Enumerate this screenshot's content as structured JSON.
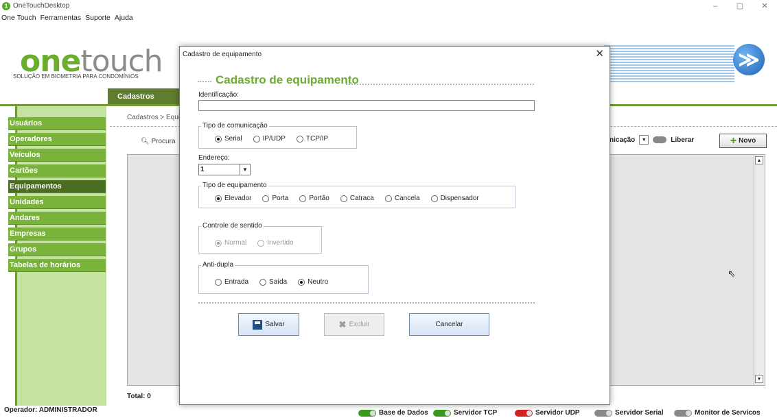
{
  "window": {
    "title": "OneTouchDesktop",
    "icon_glyph": "1",
    "minimize": "–",
    "restore": "▢",
    "close": "✕"
  },
  "menu": [
    "One Touch",
    "Ferramentas",
    "Suporte",
    "Ajuda"
  ],
  "brand": {
    "logo_one": "one",
    "logo_touch": "touch",
    "tagline": "SOLUÇÃO EM BIOMETRIA PARA CONDOMÍNIOS",
    "globe_glyph": "≫"
  },
  "main_tab": "Cadastros",
  "sidebar": {
    "items": [
      "Usuários",
      "Operadores",
      "Veículos",
      "Cartões",
      "Equipamentos",
      "Unidades",
      "Andares",
      "Empresas",
      "Grupos",
      "Tabelas de horários"
    ],
    "active": "Equipamentos"
  },
  "content": {
    "breadcrumb": "Cadastros > Equi",
    "search_label": "Procura",
    "comm_combo": "nicação",
    "liberar": "Liberar",
    "novo": "Novo",
    "total": "Total: 0"
  },
  "status": {
    "operator": "Operador: ADMINISTRADOR",
    "services": [
      {
        "label": "Base de Dados",
        "color": "#3a9a1f"
      },
      {
        "label": "Servidor TCP",
        "color": "#3a9a1f"
      },
      {
        "label": "Servidor UDP",
        "color": "#d42020"
      },
      {
        "label": "Servidor Serial",
        "color": "#8a8a8a"
      },
      {
        "label": "Monitor de Servicos",
        "color": "#8a8a8a"
      }
    ]
  },
  "dialog": {
    "title": "Cadastro de equipamento",
    "heading": "Cadastro de equipamento",
    "identificacao_label": "Identificação:",
    "identificacao_value": "",
    "comunicacao": {
      "title": "Tipo de comunicação",
      "options": [
        "Serial",
        "IP/UDP",
        "TCP/IP"
      ],
      "selected": "Serial"
    },
    "endereco": {
      "label": "Endereço:",
      "value": "1"
    },
    "equipamento": {
      "title": "Tipo de equipamento",
      "options": [
        "Elevador",
        "Porta",
        "Portão",
        "Catraca",
        "Cancela",
        "Dispensador"
      ],
      "selected": "Elevador"
    },
    "sentido": {
      "title": "Controle de sentido",
      "options": [
        "Normal",
        "Invertido"
      ],
      "selected": "Normal",
      "enabled": false
    },
    "antidupla": {
      "title": "Anti-dupla",
      "options": [
        "Entrada",
        "Saída",
        "Neutro"
      ],
      "selected": "Neutro"
    },
    "buttons": {
      "save": "Salvar",
      "delete": "Excluir",
      "cancel": "Cancelar"
    }
  }
}
